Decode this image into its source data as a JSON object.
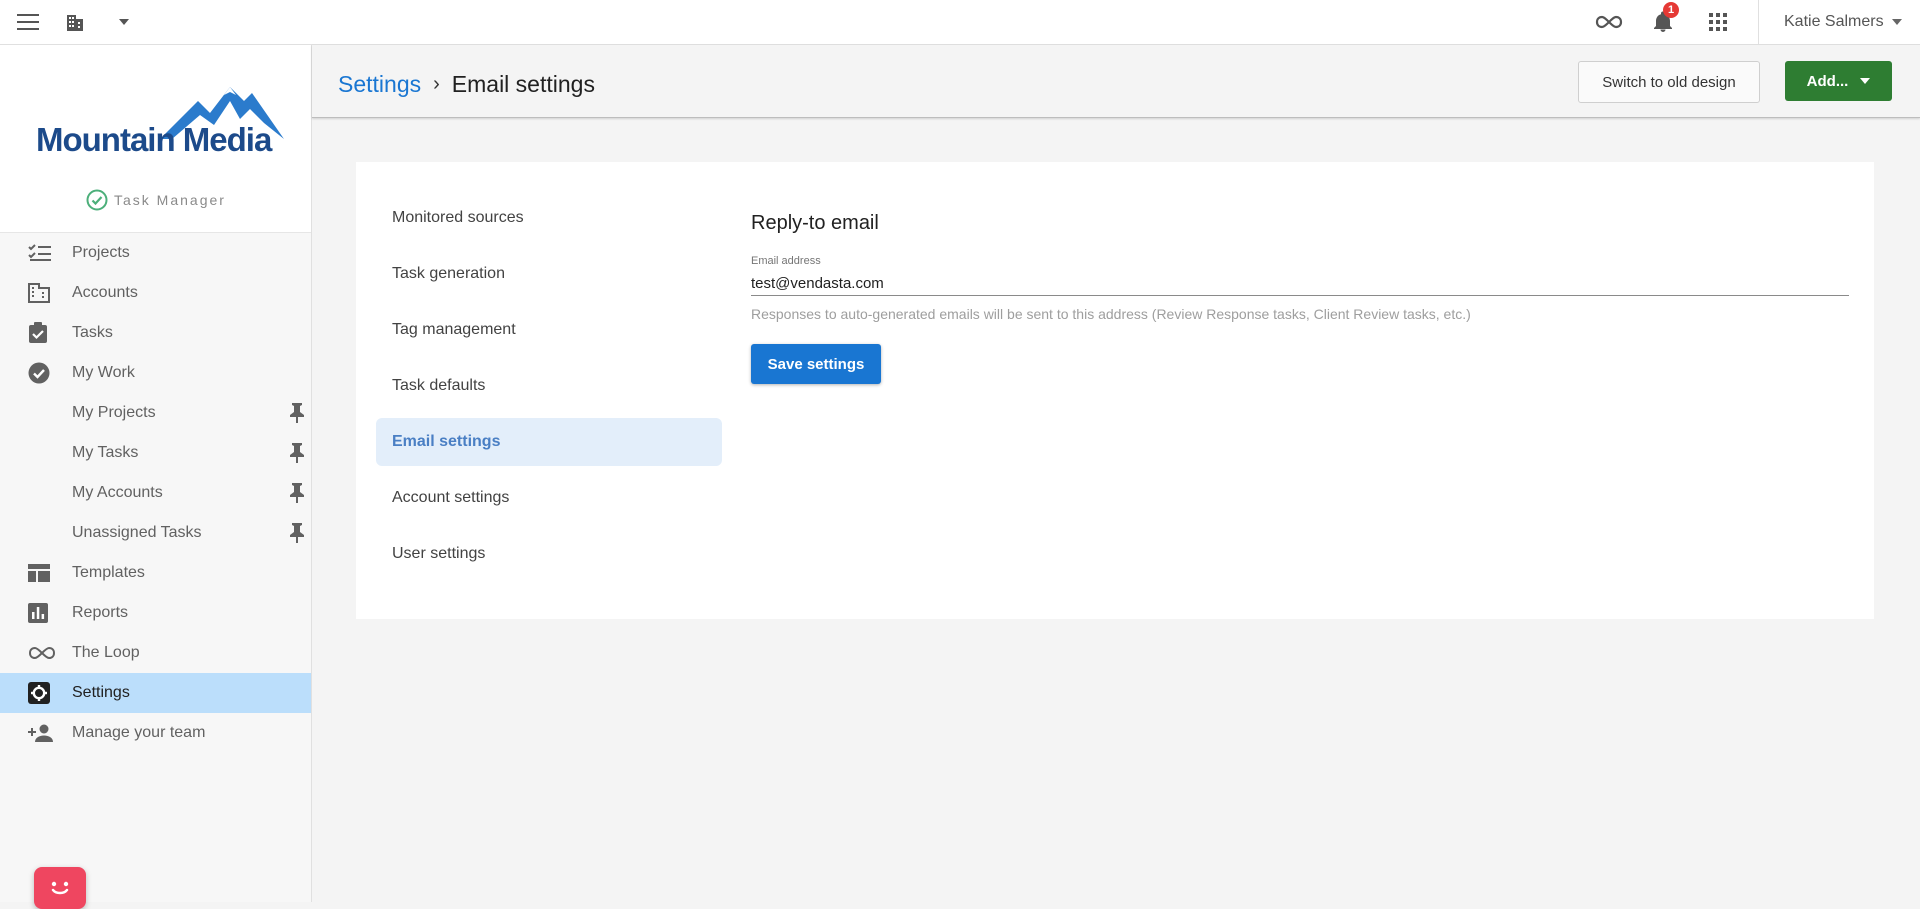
{
  "topbar": {
    "notification_count": "1",
    "user_name": "Katie Salmers"
  },
  "brand": {
    "name": "Mountain Media",
    "product": "Task Manager",
    "color": "#1c4a8a"
  },
  "sidebar": {
    "items": [
      {
        "label": "Projects",
        "icon": "checklist-icon"
      },
      {
        "label": "Accounts",
        "icon": "building-icon"
      },
      {
        "label": "Tasks",
        "icon": "clipboard-check-icon"
      },
      {
        "label": "My Work",
        "icon": "check-circle-icon"
      },
      {
        "label": "My Projects",
        "sub": true,
        "pinned": true
      },
      {
        "label": "My Tasks",
        "sub": true,
        "pinned": true
      },
      {
        "label": "My Accounts",
        "sub": true,
        "pinned": true
      },
      {
        "label": "Unassigned Tasks",
        "sub": true,
        "pinned": true
      },
      {
        "label": "Templates",
        "icon": "template-icon"
      },
      {
        "label": "Reports",
        "icon": "bar-chart-icon"
      },
      {
        "label": "The Loop",
        "icon": "infinity-icon"
      },
      {
        "label": "Settings",
        "icon": "gear-icon",
        "active": true
      },
      {
        "label": "Manage your team",
        "icon": "add-person-icon"
      }
    ]
  },
  "header": {
    "breadcrumb_root": "Settings",
    "breadcrumb_sep": "›",
    "breadcrumb_current": "Email settings",
    "switch_label": "Switch to old design",
    "add_label": "Add..."
  },
  "settings_nav": {
    "items": [
      "Monitored sources",
      "Task generation",
      "Tag management",
      "Task defaults",
      "Email settings",
      "Account settings",
      "User settings"
    ],
    "active": "Email settings"
  },
  "reply_to": {
    "heading": "Reply-to email",
    "field_label": "Email address",
    "email_value": "test@vendasta.com",
    "hint": "Responses to auto-generated emails will be sent to this address (Review Response tasks, Client Review tasks, etc.)",
    "save_label": "Save settings"
  },
  "colors": {
    "primary": "#1976d2",
    "success": "#2e7d32",
    "active_nav": "#bbdefb",
    "chat": "#ef4660"
  }
}
